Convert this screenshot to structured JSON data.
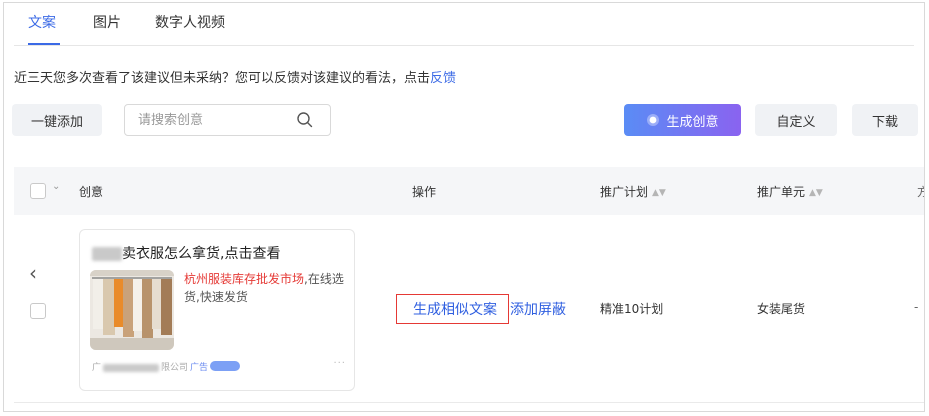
{
  "tabs": [
    {
      "label": "文案",
      "active": true
    },
    {
      "label": "图片",
      "active": false
    },
    {
      "label": "数字人视频",
      "active": false
    }
  ],
  "notice": {
    "text": "近三天您多次查看了该建议但未采纳？您可以反馈对该建议的看法，点击",
    "link": "反馈"
  },
  "toolbar": {
    "bulk_add": "一键添加",
    "search_placeholder": "请搜索创意",
    "generate": "生成创意",
    "customize": "自定义",
    "download": "下载"
  },
  "table": {
    "columns": {
      "creative": "创意",
      "operation": "操作",
      "plan": "推广计划",
      "unit": "推广单元",
      "overflow": "方"
    },
    "rows": [
      {
        "card": {
          "title_suffix": "卖衣服怎么拿货,点击查看",
          "desc_highlight": "杭州服装库存批发市场",
          "desc_rest": ",在线选货,快速发货",
          "footer_prefix": "广",
          "footer_suffix": "限公司",
          "ad_label": "广告",
          "more": "···"
        },
        "actions": {
          "similar": "生成相似文案",
          "block": "添加屏蔽"
        },
        "plan": "精准10计划",
        "unit": "女装尾货",
        "overflow": "-"
      }
    ]
  },
  "colors": {
    "accent": "#3b6ae6",
    "highlight_red": "#e53935",
    "header_bg": "#f5f6f8"
  }
}
